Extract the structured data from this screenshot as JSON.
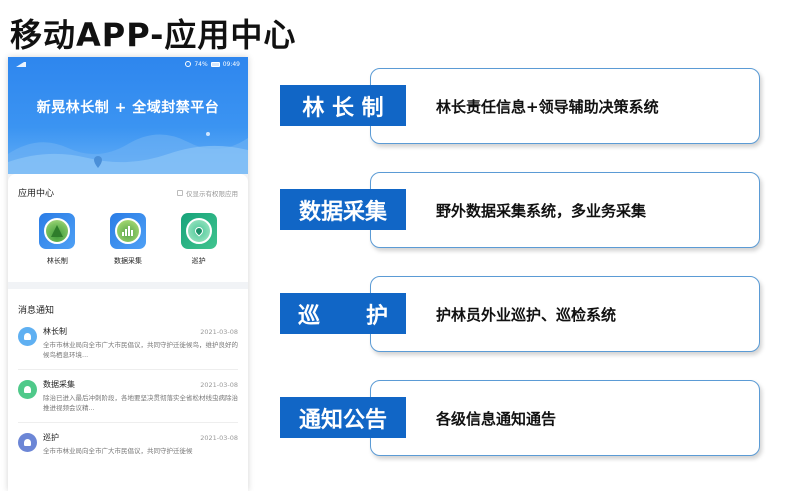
{
  "slide": {
    "title": "移动APP-应用中心"
  },
  "phone": {
    "status": {
      "battery": "74%",
      "time": "09:49"
    },
    "app_title": "新晃林长制 + 全域封禁平台",
    "app_center": {
      "title": "应用中心",
      "filter_label": "仅显示有权限应用",
      "apps": [
        {
          "label": "林长制",
          "icon": "forest-icon"
        },
        {
          "label": "数据采集",
          "icon": "data-collect-icon"
        },
        {
          "label": "巡护",
          "icon": "patrol-location-icon"
        }
      ]
    },
    "notices": {
      "title": "消息通知",
      "items": [
        {
          "name": "林长制",
          "date": "2021-03-08",
          "text": "全市市林业局向全市广大市民倡议，共同守护迁徙候鸟，维护良好的候鸟栖息环境..."
        },
        {
          "name": "数据采集",
          "date": "2021-03-08",
          "text": "除治已进入最后冲刺阶段，各地要坚决贯彻落实全省松材线虫病除治推进视频会议精..."
        },
        {
          "name": "巡护",
          "date": "2021-03-08",
          "text": "全市市林业局向全市广大市民倡议，共同守护迁徙候"
        }
      ]
    }
  },
  "features": [
    {
      "label": "林 长 制",
      "desc": "林长责任信息+领导辅助决策系统"
    },
    {
      "label": "数据采集",
      "desc": "野外数据采集系统，多业务采集"
    },
    {
      "label": "巡      护",
      "desc": "护林员外业巡护、巡检系统"
    },
    {
      "label": "通知公告",
      "desc": "各级信息通知通告"
    }
  ],
  "colors": {
    "label_bg": "#1166c6",
    "box_border": "#5b9bd5",
    "phone_header": "#3b94f2"
  }
}
